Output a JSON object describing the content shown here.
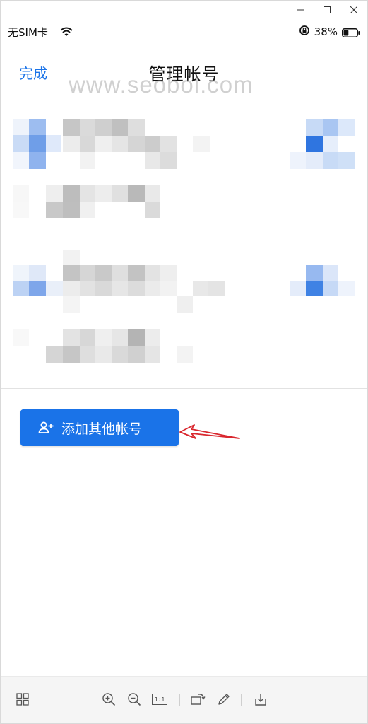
{
  "status_bar": {
    "carrier": "无SIM卡",
    "battery_percent": "38%",
    "battery_level": 0.38
  },
  "header": {
    "done_label": "完成",
    "title": "管理帐号"
  },
  "watermark": "www.seobol.com",
  "add_account": {
    "label": "添加其他帐号"
  },
  "toolbar": {
    "actual_size_label": "1:1"
  },
  "colors": {
    "accent": "#1a73e8",
    "annotation_arrow": "#d9272e"
  },
  "icons": {
    "window": [
      "minimize-icon",
      "maximize-icon",
      "close-icon"
    ],
    "toolbar": [
      "grid-icon",
      "zoom-in-icon",
      "zoom-out-icon",
      "actual-size-icon",
      "rotate-icon",
      "edit-icon",
      "download-icon"
    ]
  }
}
